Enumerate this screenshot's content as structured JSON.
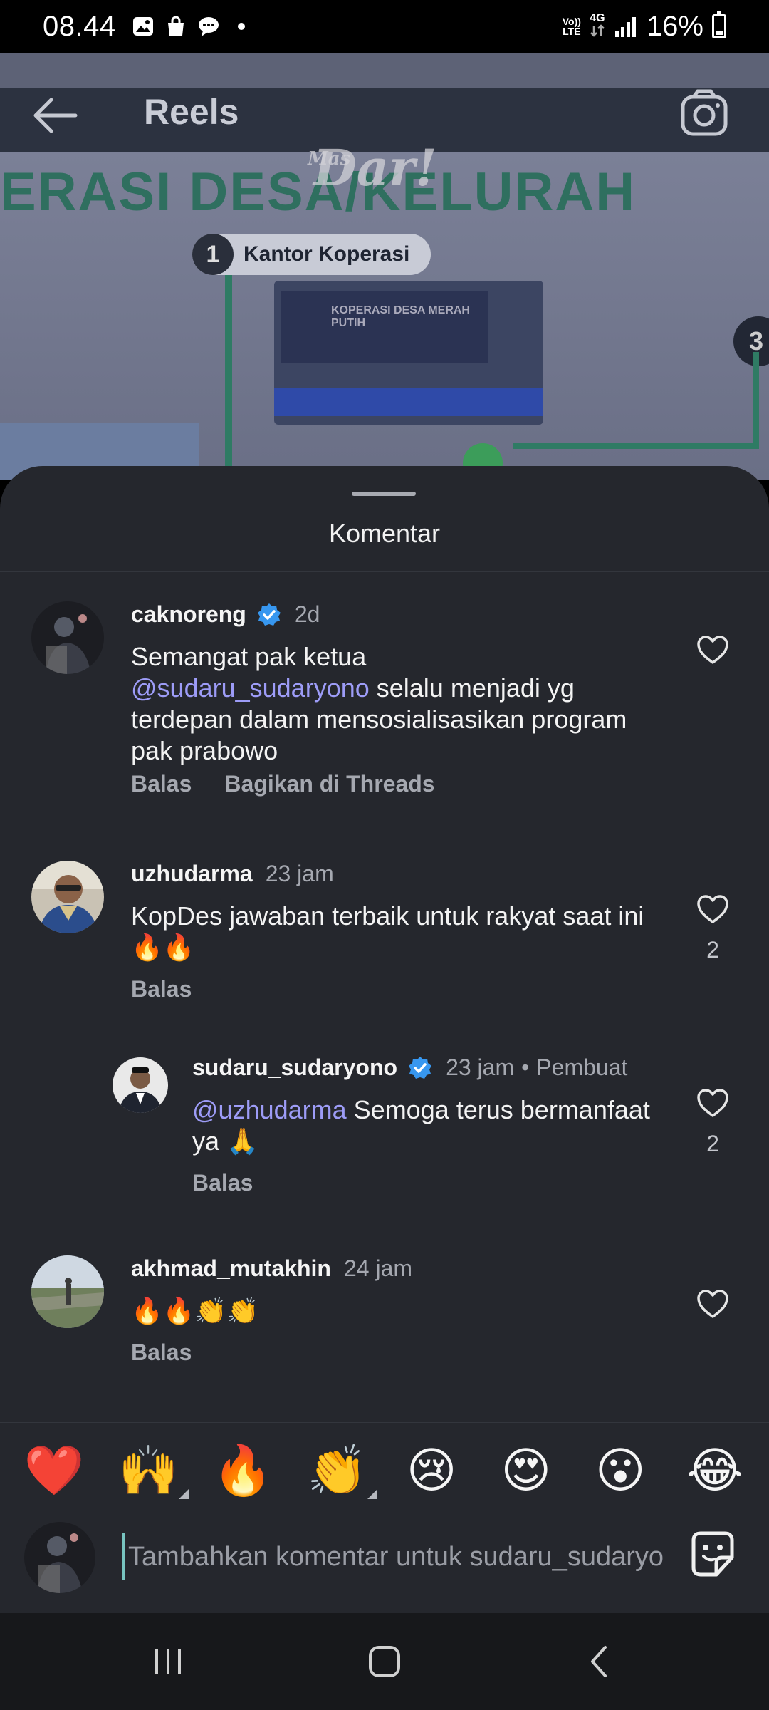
{
  "status_bar": {
    "time": "08.44",
    "volte_top": "Vo))",
    "volte_bottom": "LTE",
    "network": "4G",
    "battery": "16%"
  },
  "video": {
    "headline": "ERASI DESA/KELURAH",
    "watermark_small": "Mas",
    "watermark": "Dar!",
    "step_number": "1",
    "step_label": "Kantor Koperasi",
    "step_right_number": "3",
    "sign_text": "KOPERASI DESA MERAH PUTIH"
  },
  "header": {
    "title": "Reels"
  },
  "sheet": {
    "title": "Komentar"
  },
  "comments": [
    {
      "username": "caknoreng",
      "verified": true,
      "time": "2d",
      "text_before": "Semangat pak ketua",
      "mention": "@sudaru_sudaryono",
      "text_after": " selalu menjadi yg terdepan dalam mensosialisasikan program pak prabowo",
      "reply": "Balas",
      "share": "Bagikan di Threads"
    },
    {
      "username": "uzhudarma",
      "time": "23 jam",
      "text": "KopDes jawaban terbaik untuk rakyat saat ini 🔥🔥",
      "reply": "Balas",
      "likes": "2"
    },
    {
      "username": "sudaru_sudaryono",
      "verified": true,
      "time": "23 jam",
      "separator": "•",
      "creator_label": "Pembuat",
      "mention": "@uzhudarma",
      "text_after": " Semoga terus bermanfaat ya 🙏",
      "reply": "Balas",
      "likes": "2"
    },
    {
      "username": "akhmad_mutakhin",
      "time": "24 jam",
      "text": "🔥🔥👏👏",
      "reply": "Balas"
    }
  ],
  "reactions": [
    "❤️",
    "🙌",
    "🔥",
    "👏",
    "😢",
    "😍",
    "😮",
    "😂"
  ],
  "input": {
    "placeholder": "Tambahkan komentar untuk sudaru_sudaryono..."
  },
  "colors": {
    "sheet_bg": "#25272d",
    "mention": "#9d9cf7",
    "verified": "#3797f0",
    "muted": "#a5a8b0"
  },
  "icons": [
    "back-arrow-icon",
    "camera-icon",
    "verified-badge-icon",
    "heart-outline-icon",
    "sticker-icon",
    "recent-apps-icon",
    "home-icon",
    "nav-back-icon"
  ]
}
